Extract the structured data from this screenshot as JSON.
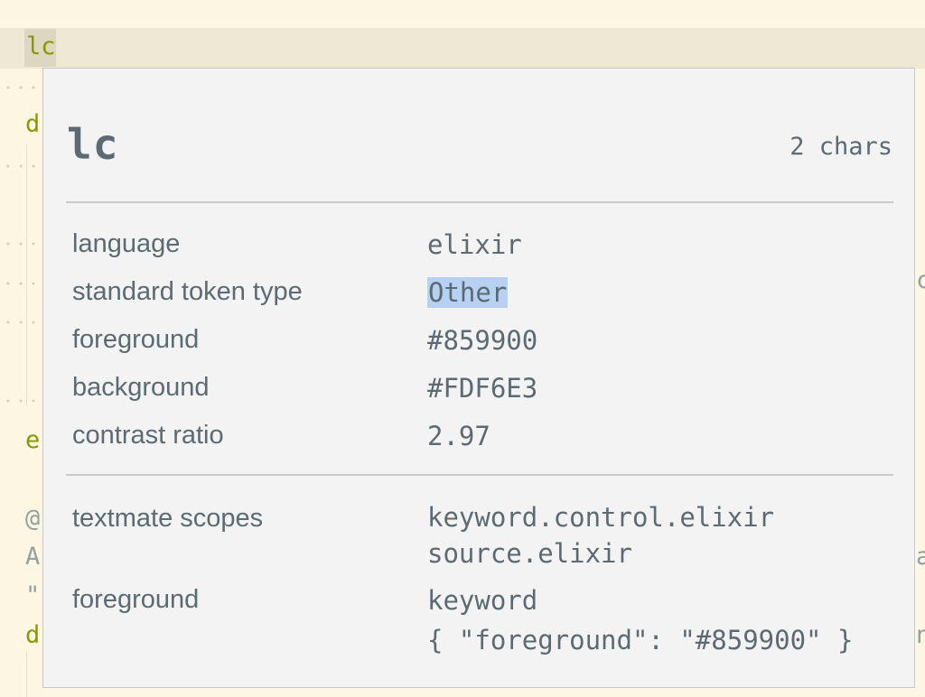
{
  "editor": {
    "current_token": "lc",
    "line_starts": [
      "d",
      "e",
      "@",
      "A",
      "\"",
      "d"
    ],
    "right_peek": [
      "c",
      "a",
      "n"
    ]
  },
  "inspector": {
    "token": "lc",
    "length": "2 chars",
    "rows": [
      {
        "label": "language",
        "value": "elixir"
      },
      {
        "label": "standard token type",
        "value": "Other"
      },
      {
        "label": "foreground",
        "value": "#859900"
      },
      {
        "label": "background",
        "value": "#FDF6E3"
      },
      {
        "label": "contrast ratio",
        "value": "2.97"
      }
    ],
    "scopes_label": "textmate scopes",
    "scopes": [
      "keyword.control.elixir",
      "source.elixir"
    ],
    "theme_label": "foreground",
    "theme_rule": "keyword",
    "theme_value": "{ \"foreground\": \"#859900\" }"
  },
  "colors": {
    "editor_bg": "#fdf6e3",
    "keyword": "#859900",
    "popup_bg": "#f3f3f3",
    "selection": "#b7d1f3"
  }
}
